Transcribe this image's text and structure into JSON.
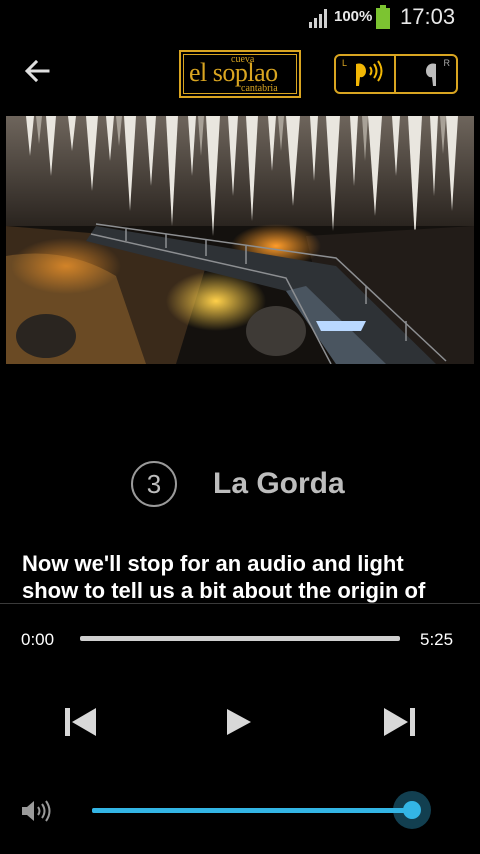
{
  "status_bar": {
    "battery_percent": "100%",
    "time": "17:03",
    "icons": [
      "signal-icon",
      "battery-icon"
    ]
  },
  "app_bar": {
    "back_icon": "arrow-left-icon",
    "logo": {
      "top_text": "cueva",
      "main_text": "el soplao",
      "bottom_text": "cantabria"
    },
    "channel_toggle": {
      "left_letter": "L",
      "right_letter": "R",
      "selected": "L",
      "accent_color": "#d9a521"
    }
  },
  "stop": {
    "number": "3",
    "title": "La Gorda",
    "description": "Now we'll stop for an audio and light show to tell us a bit about the origin of"
  },
  "player": {
    "elapsed": "0:00",
    "total": "5:25",
    "progress": 0,
    "volume": 1.0,
    "accent_color": "#33b5e5",
    "controls": [
      "skip-previous-icon",
      "play-icon",
      "skip-next-icon"
    ],
    "volume_icon": "speaker-icon"
  }
}
